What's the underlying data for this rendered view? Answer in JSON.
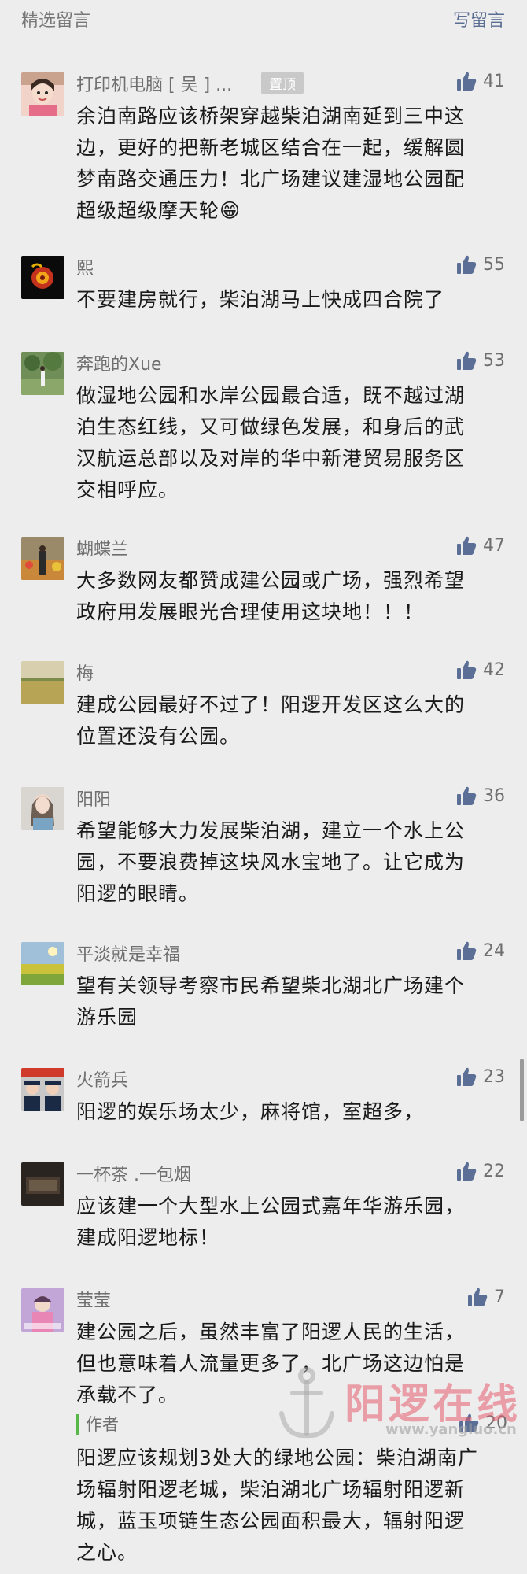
{
  "header": {
    "title": "精选留言",
    "write_label": "写留言"
  },
  "comments": [
    {
      "nickname": "打印机电脑 [ 吴 ] ...",
      "pinned_label": "置顶",
      "likes": "41",
      "lines": [
        "余泊南路应该桥架穿越柴泊湖南延到三中这",
        "边，更好的把新老城区结合在一起，缓解圆",
        "梦南路交通压力！北广场建议建湿地公园配",
        "超级超级摩天轮😁"
      ]
    },
    {
      "nickname": "熙",
      "likes": "55",
      "lines": [
        "不要建房就行，柴泊湖马上快成四合院了"
      ]
    },
    {
      "nickname": "奔跑的Xue",
      "likes": "53",
      "lines": [
        "做湿地公园和水岸公园最合适，既不越过湖",
        "泊生态红线，又可做绿色发展，和身后的武",
        "汉航运总部以及对岸的华中新港贸易服务区",
        "交相呼应。"
      ]
    },
    {
      "nickname": "蝴蝶兰",
      "likes": "47",
      "lines": [
        "大多数网友都赞成建公园或广场，强烈希望",
        "政府用发展眼光合理使用这块地！！！"
      ]
    },
    {
      "nickname": "梅",
      "likes": "42",
      "lines": [
        "建成公园最好不过了！阳逻开发区这么大的",
        "位置还没有公园。"
      ]
    },
    {
      "nickname": "阳阳",
      "likes": "36",
      "lines": [
        "希望能够大力发展柴泊湖，建立一个水上公",
        "园，不要浪费掉这块风水宝地了。让它成为",
        "阳逻的眼睛。"
      ]
    },
    {
      "nickname": "平淡就是幸福",
      "likes": "24",
      "lines": [
        "望有关领导考察市民希望柴北湖北广场建个",
        "游乐园"
      ]
    },
    {
      "nickname": "火箭兵",
      "likes": "23",
      "lines": [
        "阳逻的娱乐场太少，麻将馆，室超多，"
      ]
    },
    {
      "nickname": "一杯茶 .一包烟",
      "likes": "22",
      "lines": [
        "应该建一个大型水上公园式嘉年华游乐园，",
        "建成阳逻地标！"
      ]
    },
    {
      "nickname": "莹莹",
      "likes": "7",
      "lines": [
        "建公园之后，虽然丰富了阳逻人民的生活，",
        "但也意味着人流量更多了，北广场这边怕是",
        "承载不了。"
      ]
    }
  ],
  "author_reply": {
    "label": "作者",
    "likes": "20",
    "lines": [
      "阳逻应该规划3处大的绿地公园：柴泊湖南广",
      "场辐射阳逻老城，柴泊湖北广场辐射阳逻新",
      "城，蓝玉项链生态公园面积最大，辐射阳逻",
      "之心。"
    ]
  },
  "watermark": {
    "title": "阳逻在线",
    "url": "www.yangluo.cn"
  },
  "icons": {
    "like": "thumbs-up-icon",
    "watermark_logo": "anchor-icon"
  },
  "colors": {
    "background": "#ededed",
    "link": "#5a6d93",
    "like_icon": "#5b6f96",
    "author_accent": "#55b847"
  }
}
